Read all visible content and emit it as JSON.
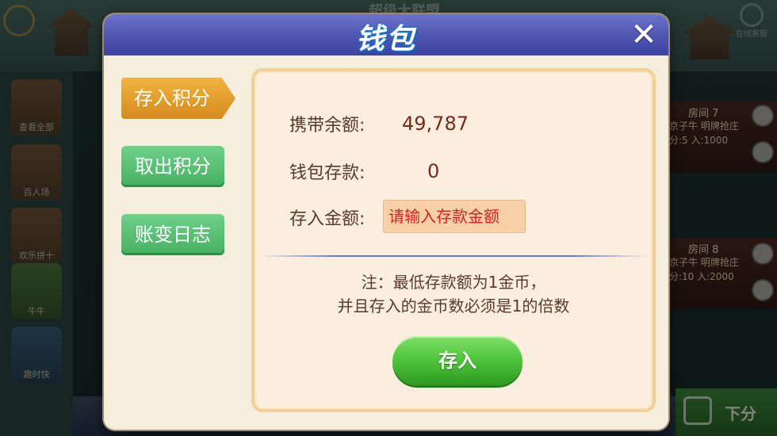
{
  "background": {
    "lobby_title": "超级大联盟",
    "online_label": "在线客服",
    "games": [
      {
        "label": "查看全部"
      },
      {
        "label": "百人场"
      },
      {
        "label": "欢乐拼十"
      },
      {
        "label": "牛牛"
      },
      {
        "label": "趣时快"
      }
    ],
    "rooms": [
      {
        "name": "房间 7",
        "line1": "京子牛  明牌抢庄",
        "line2": "分:5   入:1000"
      },
      {
        "name": "房间 8",
        "line1": "京子牛  明牌抢庄",
        "line2": "分:10  入:2000"
      }
    ],
    "bottom_right_label": "下分"
  },
  "modal": {
    "title": "钱包",
    "close_glyph": "✕",
    "tabs": [
      {
        "label": "存入积分",
        "active": true
      },
      {
        "label": "取出积分",
        "active": false
      },
      {
        "label": "账变日志",
        "active": false
      }
    ],
    "carry_balance_label": "携带余额:",
    "carry_balance_value": "49,787",
    "wallet_deposit_label": "钱包存款:",
    "wallet_deposit_value": "0",
    "deposit_amount_label": "存入金额:",
    "deposit_amount_placeholder": "请输入存款金额",
    "deposit_amount_value": "",
    "note_line1": "注：最低存款额为1金币，",
    "note_line2": "并且存入的金币数必须是1的倍数",
    "deposit_button": "存入"
  },
  "colors": {
    "header": "#4e55b0",
    "active_tab": "#e8a030",
    "green_tab": "#52b86a",
    "deposit_button": "#4cc23a",
    "placeholder_text": "#e02020"
  }
}
